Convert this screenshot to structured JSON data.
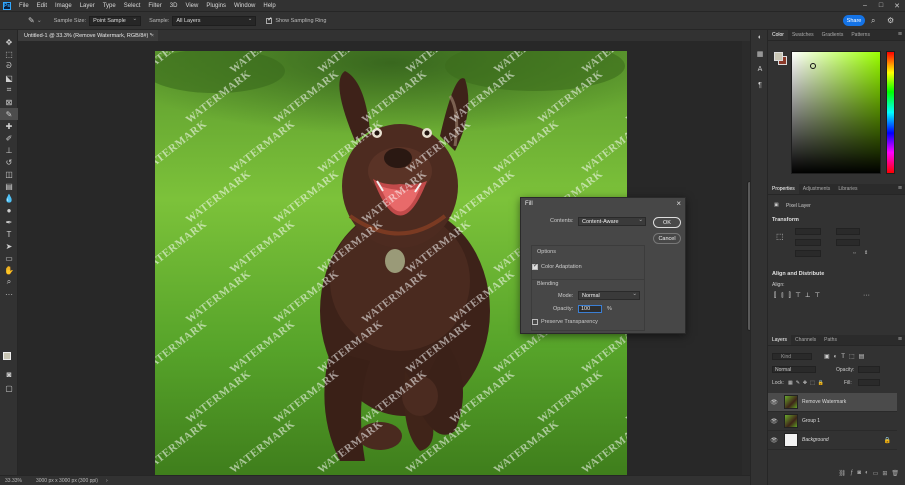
{
  "app": {
    "logo": "Ps",
    "menu": [
      "File",
      "Edit",
      "Image",
      "Layer",
      "Type",
      "Select",
      "Filter",
      "3D",
      "View",
      "Plugins",
      "Window",
      "Help"
    ]
  },
  "options_bar": {
    "sample_size_label": "Sample Size:",
    "sample_size_value": "Point Sample",
    "sample_label": "Sample:",
    "sample_value": "All Layers",
    "sampling_ring_label": "Show Sampling Ring",
    "share_label": "Share"
  },
  "document": {
    "tab_title": "Untitled-1 @ 33.3% (Remove Watermark, RGB/8#) *",
    "watermark_text": "WATERMARK"
  },
  "status_bar": {
    "zoom": "33.33%",
    "doc_info": "3000 px x 3000 px (300 ppi)"
  },
  "color_panel": {
    "tabs": [
      "Color",
      "Swatches",
      "Gradients",
      "Patterns"
    ],
    "foreground": "#c9c6b4",
    "background": "#8b3a2a"
  },
  "properties_panel": {
    "tabs": [
      "Properties",
      "Adjustments",
      "Libraries"
    ],
    "layer_type": "Pixel Layer",
    "transform": "Transform",
    "align": "Align and Distribute",
    "align_label": "Align:"
  },
  "layers_panel": {
    "tabs": [
      "Layers",
      "Channels",
      "Paths"
    ],
    "kind_placeholder": "Kind",
    "blend_mode": "Normal",
    "opacity_label": "Opacity:",
    "lock_label": "Lock:",
    "fill_label": "Fill:",
    "layers": [
      {
        "name": "Remove Watermark",
        "selected": true,
        "thumb": "img"
      },
      {
        "name": "Group 1",
        "selected": false,
        "thumb": "img"
      },
      {
        "name": "Background",
        "selected": false,
        "thumb": "white"
      }
    ]
  },
  "fill_dialog": {
    "title": "Fill",
    "contents_label": "Contents:",
    "contents_value": "Content-Aware",
    "ok_label": "OK",
    "cancel_label": "Cancel",
    "options_label": "Options",
    "color_adaptation_label": "Color Adaptation",
    "blending_label": "Blending",
    "mode_label": "Mode:",
    "mode_value": "Normal",
    "opacity_label": "Opacity:",
    "opacity_value": "100",
    "opacity_unit": "%",
    "preserve_transparency_label": "Preserve Transparency"
  }
}
